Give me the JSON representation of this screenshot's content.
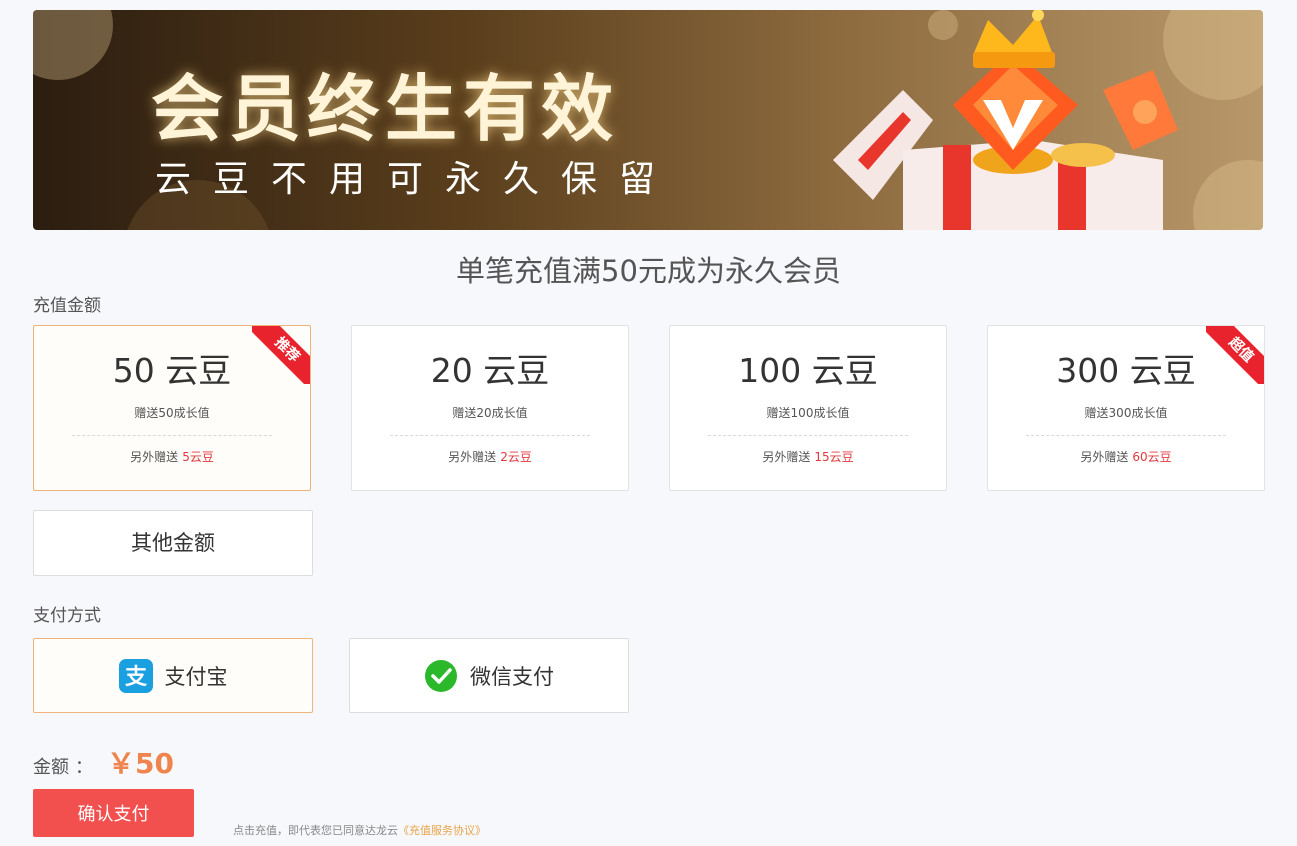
{
  "banner": {
    "title": "会员终生有效",
    "subtitle": "云豆不用可永久保留"
  },
  "headline": "单笔充值满50元成为永久会员",
  "recharge": {
    "label": "充值金额",
    "bonus_prefix": "另外赠送",
    "cards": [
      {
        "amount": "50 云豆",
        "growth": "赠送50成长值",
        "bonus": "5云豆",
        "tag": "推荐",
        "selected": true
      },
      {
        "amount": "20 云豆",
        "growth": "赠送20成长值",
        "bonus": "2云豆",
        "tag": "",
        "selected": false
      },
      {
        "amount": "100 云豆",
        "growth": "赠送100成长值",
        "bonus": "15云豆",
        "tag": "",
        "selected": false
      },
      {
        "amount": "300 云豆",
        "growth": "赠送300成长值",
        "bonus": "60云豆",
        "tag": "超值",
        "selected": false
      }
    ],
    "other_label": "其他金额"
  },
  "payment": {
    "label": "支付方式",
    "methods": [
      {
        "label": "支付宝",
        "icon": "alipay-icon",
        "color": "#1a9fe0",
        "selected": true
      },
      {
        "label": "微信支付",
        "icon": "wechat-pay-icon",
        "color": "#2bb82b",
        "selected": false
      }
    ]
  },
  "total": {
    "label": "金额",
    "colon": "：",
    "value": "￥50"
  },
  "confirm_label": "确认支付",
  "agreement": {
    "text": "点击充值，即代表您已同意达龙云",
    "link": "《充值服务协议》"
  },
  "colors": {
    "accent": "#f24f4f",
    "bonus_red": "#e0383e",
    "selected_border": "#f0b47a",
    "amount_orange": "#f0844e",
    "ribbon_red": "#e8232d"
  }
}
